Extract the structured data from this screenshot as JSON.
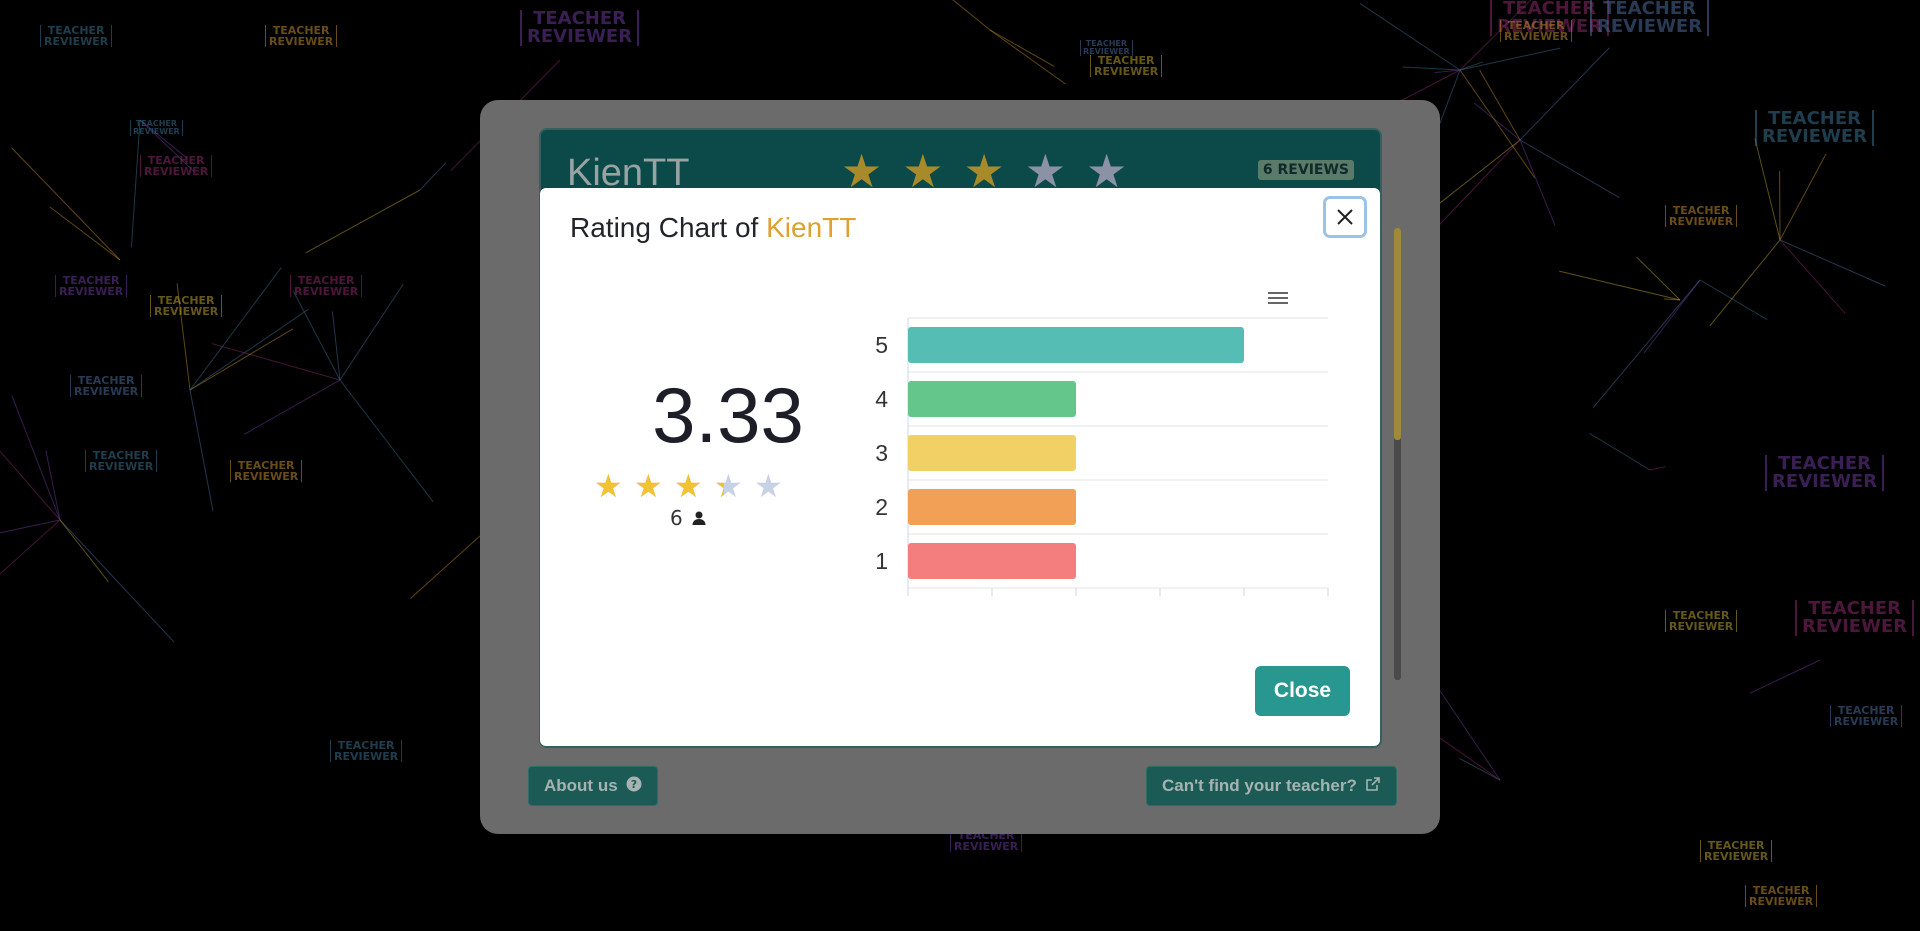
{
  "background": {
    "watermark_text": "TEACHER\nREVIEWER",
    "colors": [
      "#3a6f8a",
      "#c08a2a",
      "#6a3a9a",
      "#b8a030",
      "#8a2a6a",
      "#4a6a9a"
    ]
  },
  "teacher_card": {
    "name": "KienTT",
    "rating_stars": 3,
    "rating_max": 5,
    "reviews_badge": "6 REVIEWS"
  },
  "footer": {
    "about_label": "About us",
    "about_icon": "question-circle-icon",
    "find_label": "Can't find your teacher?",
    "find_icon": "external-link-icon"
  },
  "modal": {
    "title_prefix": "Rating Chart of",
    "title_name": "KienTT",
    "close_icon": "close-icon",
    "average": "3.33",
    "average_value": 3.33,
    "voter_count": "6",
    "voter_icon": "person-icon",
    "menu_icon": "hamburger-menu-icon",
    "close_button_label": "Close",
    "accent_color": "#27978f",
    "name_color": "#e0a030"
  },
  "chart_data": {
    "type": "bar",
    "orientation": "horizontal",
    "categories": [
      "5",
      "4",
      "3",
      "2",
      "1"
    ],
    "values": [
      2,
      1,
      1,
      1,
      1
    ],
    "colors": [
      "#56bdb5",
      "#64c68a",
      "#f1d066",
      "#f1a055",
      "#f47e7e"
    ],
    "xlim": [
      0,
      2.5
    ],
    "x_tick_count": 6,
    "grid": true,
    "legend": "none"
  }
}
